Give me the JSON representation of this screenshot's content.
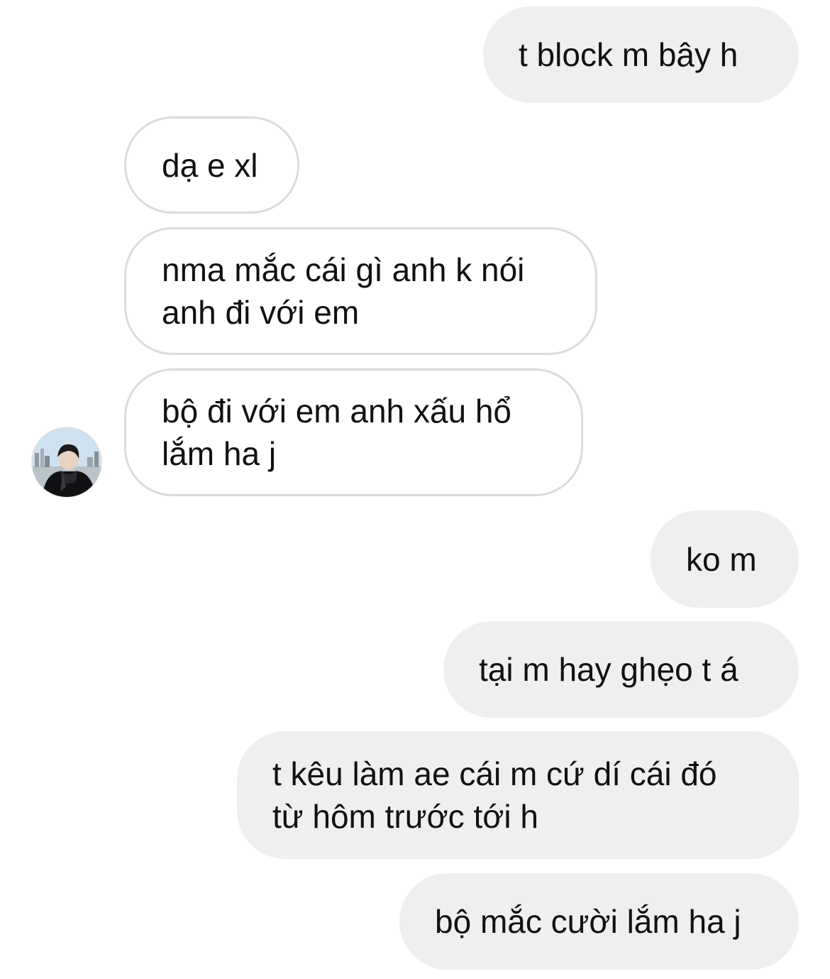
{
  "conversation": {
    "messages": [
      {
        "sender": "me",
        "text": "t block m bây h"
      },
      {
        "sender": "them",
        "text": "dạ e xl"
      },
      {
        "sender": "them",
        "lines": [
          "nma mắc cái gì anh k nói",
          "anh đi với em"
        ]
      },
      {
        "sender": "them",
        "lines": [
          "bộ đi với em anh xấu hổ",
          "lắm ha j"
        ]
      },
      {
        "sender": "me",
        "text": "ko m"
      },
      {
        "sender": "me",
        "text": "tại m hay ghẹo t á"
      },
      {
        "sender": "me",
        "lines": [
          "t kêu làm ae cái m cứ dí cái đó",
          "từ hôm trước tới h"
        ]
      },
      {
        "sender": "me",
        "text": "bộ mắc cười lắm ha j"
      }
    ],
    "contact_avatar": {
      "icon": "profile-photo-avatar"
    }
  },
  "colors": {
    "sent_bubble": "#efefef",
    "received_bubble_border": "#dbdbdb",
    "text": "#111111",
    "background": "#ffffff"
  }
}
